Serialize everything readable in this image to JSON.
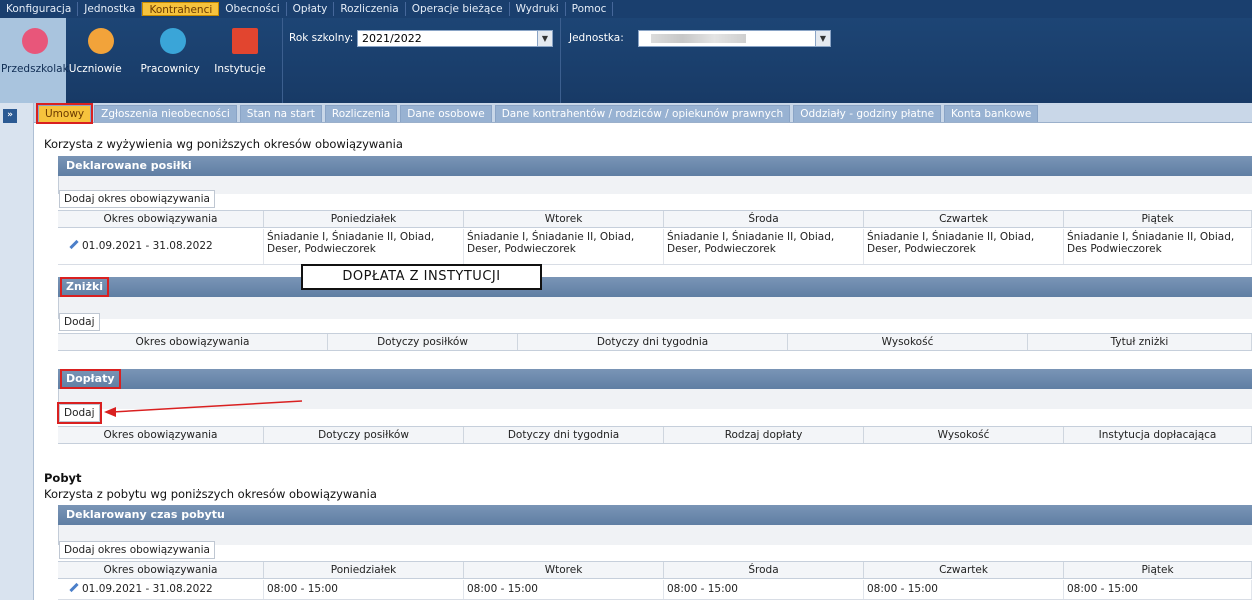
{
  "menu": [
    "Konfiguracja",
    "Jednostka",
    "Kontrahenci",
    "Obecności",
    "Opłaty",
    "Rozliczenia",
    "Operacje bieżące",
    "Wydruki",
    "Pomoc"
  ],
  "menu_active_index": 2,
  "modules": [
    {
      "label": "Przedszkolaki",
      "icon": "child-icon",
      "color": "#e8567a"
    },
    {
      "label": "Uczniowie",
      "icon": "students-icon",
      "color": "#f2a33a"
    },
    {
      "label": "Pracownicy",
      "icon": "employee-icon",
      "color": "#3aa5d8"
    },
    {
      "label": "Instytucje",
      "icon": "building-icon",
      "color": "#e2452f"
    }
  ],
  "selectors": {
    "year_label": "Rok szkolny:",
    "year_value": "2021/2022",
    "unit_label": "Jednostka:"
  },
  "tabs": [
    "Umowy",
    "Zgłoszenia nieobecności",
    "Stan na start",
    "Rozliczenia",
    "Dane osobowe",
    "Dane kontrahentów / rodziców / opiekunów prawnych",
    "Oddziały - godziny płatne",
    "Konta bankowe"
  ],
  "tabs_active_index": 0,
  "meals": {
    "intro": "Korzysta z wyżywienia wg poniższych okresów obowiązywania",
    "declared": {
      "title": "Deklarowane posiłki",
      "add_button": "Dodaj okres obowiązywania",
      "columns": [
        "Okres obowiązywania",
        "Poniedziałek",
        "Wtorek",
        "Środa",
        "Czwartek",
        "Piątek"
      ],
      "row": {
        "period": "01.09.2021 - 31.08.2022",
        "days": [
          "Śniadanie I, Śniadanie II, Obiad, Deser, Podwieczorek",
          "Śniadanie I, Śniadanie II, Obiad, Deser, Podwieczorek",
          "Śniadanie I, Śniadanie II, Obiad, Deser, Podwieczorek",
          "Śniadanie I, Śniadanie II, Obiad, Deser, Podwieczorek",
          "Śniadanie I, Śniadanie II, Obiad, Des Podwieczorek"
        ]
      }
    },
    "discounts": {
      "title": "Zniżki",
      "add_button": "Dodaj",
      "columns": [
        "Okres obowiązywania",
        "Dotyczy posiłków",
        "Dotyczy dni tygodnia",
        "Wysokość",
        "Tytuł zniżki"
      ]
    },
    "surcharges": {
      "title": "Dopłaty",
      "add_button": "Dodaj",
      "columns": [
        "Okres obowiązywania",
        "Dotyczy posiłków",
        "Dotyczy dni tygodnia",
        "Rodzaj dopłaty",
        "Wysokość",
        "Instytucja dopłacająca"
      ]
    }
  },
  "annotation": "DOPŁATA Z INSTYTUCJI",
  "stay": {
    "heading": "Pobyt",
    "intro": "Korzysta z pobytu wg poniższych okresów obowiązywania",
    "title": "Deklarowany czas pobytu",
    "add_button": "Dodaj okres obowiązywania",
    "columns": [
      "Okres obowiązywania",
      "Poniedziałek",
      "Wtorek",
      "Środa",
      "Czwartek",
      "Piątek"
    ],
    "row": {
      "period": "01.09.2021 - 31.08.2022",
      "days": [
        "08:00 - 15:00",
        "08:00 - 15:00",
        "08:00 - 15:00",
        "08:00 - 15:00",
        "08:00 - 15:00"
      ]
    }
  },
  "colors": {
    "accent": "#f6c33d",
    "header_blue": "#1a3f6e",
    "annotation_red": "#d92020"
  }
}
